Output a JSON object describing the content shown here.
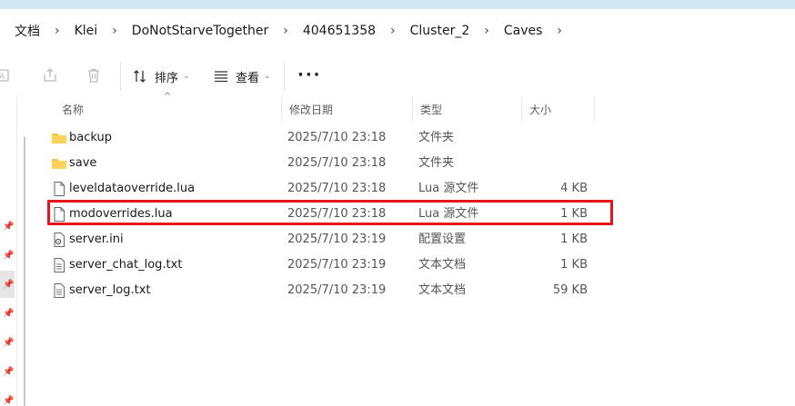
{
  "breadcrumb": [
    "文档",
    "Klei",
    "DoNotStarveTogether",
    "404651358",
    "Cluster_2",
    "Caves"
  ],
  "toolbar": {
    "sort_label": "排序",
    "view_label": "查看",
    "more_label": "···"
  },
  "columns": {
    "name": "名称",
    "date": "修改日期",
    "type": "类型",
    "size": "大小"
  },
  "files": [
    {
      "name": "backup",
      "date": "2025/7/10 23:18",
      "type": "文件夹",
      "size": "",
      "icon": "folder-icon"
    },
    {
      "name": "save",
      "date": "2025/7/10 23:18",
      "type": "文件夹",
      "size": "",
      "icon": "folder-icon"
    },
    {
      "name": "leveldataoverride.lua",
      "date": "2025/7/10 23:18",
      "type": "Lua 源文件",
      "size": "4 KB",
      "icon": "file-icon"
    },
    {
      "name": "modoverrides.lua",
      "date": "2025/7/10 23:18",
      "type": "Lua 源文件",
      "size": "1 KB",
      "icon": "file-icon"
    },
    {
      "name": "server.ini",
      "date": "2025/7/10 23:19",
      "type": "配置设置",
      "size": "1 KB",
      "icon": "settings-file-icon"
    },
    {
      "name": "server_chat_log.txt",
      "date": "2025/7/10 23:19",
      "type": "文本文档",
      "size": "1 KB",
      "icon": "text-file-icon"
    },
    {
      "name": "server_log.txt",
      "date": "2025/7/10 23:19",
      "type": "文本文档",
      "size": "59 KB",
      "icon": "text-file-icon"
    }
  ],
  "colors": {
    "highlight": "#e8141d",
    "folder": "#f5c342",
    "top_strip": "#d3e7f2"
  }
}
